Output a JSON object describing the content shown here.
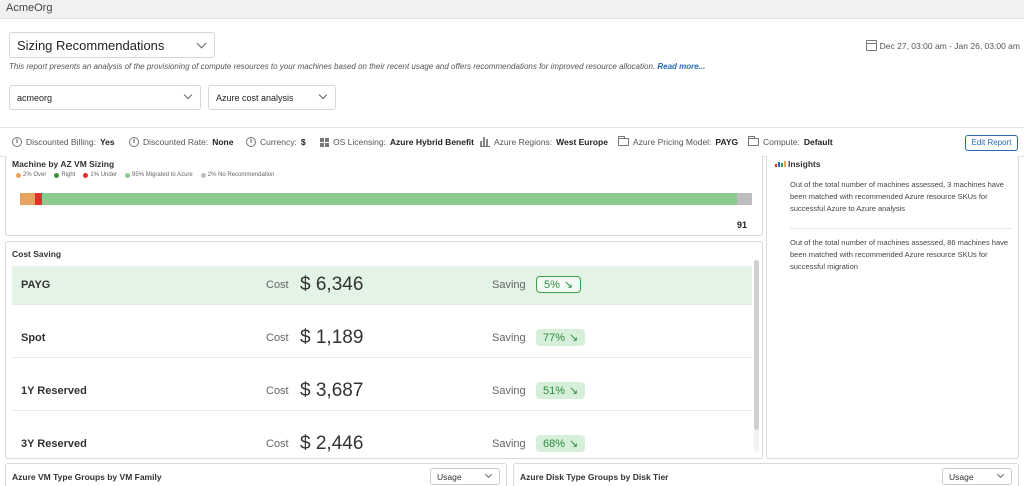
{
  "app": {
    "org": "AcmeOrg"
  },
  "report": {
    "selected": "Sizing Recommendations",
    "date_range": "Dec 27, 03:00 am - Jan 26, 03:00 am",
    "description": "This report presents an analysis of the provisioning of compute resources to your machines based on their recent usage and offers recommendations for improved resource allocation.",
    "read_more": "Read more..."
  },
  "filters": {
    "org": "acmeorg",
    "analysis": "Azure cost analysis"
  },
  "infobar": {
    "discounted_billing": {
      "label": "Discounted Billing:",
      "value": "Yes"
    },
    "discounted_rate": {
      "label": "Discounted Rate:",
      "value": "None"
    },
    "currency": {
      "label": "Currency:",
      "value": "$"
    },
    "os_licensing": {
      "label": "OS Licensing:",
      "value": "Azure Hybrid Benefit"
    },
    "regions": {
      "label": "Azure Regions:",
      "value": "West Europe"
    },
    "pricing_model": {
      "label": "Azure Pricing Model:",
      "value": "PAYG"
    },
    "compute": {
      "label": "Compute:",
      "value": "Default"
    },
    "edit_button": "Edit Report"
  },
  "sizing": {
    "title": "Machine by AZ VM Sizing",
    "legend": [
      {
        "label": "2% Over",
        "color": "#e8a25f",
        "pct": 2
      },
      {
        "label": "Right",
        "color": "#3f8f3f",
        "pct": 0
      },
      {
        "label": "1% Under",
        "color": "#e0312f",
        "pct": 1
      },
      {
        "label": "95% Migrated to Azure",
        "color": "#8cc98c",
        "pct": 95
      },
      {
        "label": "2% No Recommendation",
        "color": "#bdbdbd",
        "pct": 2
      }
    ],
    "total": "91"
  },
  "insights": {
    "title": "Insights",
    "items": [
      "Out of the total number of machines assessed, 3 machines have been matched with recommended Azure resource SKUs for successful Azure to Azure analysis",
      "Out of the total number of machines assessed, 86 machines have been matched with recommended Azure resource SKUs for successful migration"
    ]
  },
  "cost_saving": {
    "title": "Cost Saving",
    "cost_label": "Cost",
    "saving_label": "Saving",
    "rows": [
      {
        "plan": "PAYG",
        "cost": "$ 6,346",
        "saving": "5%"
      },
      {
        "plan": "Spot",
        "cost": "$ 1,189",
        "saving": "77%"
      },
      {
        "plan": "1Y Reserved",
        "cost": "$ 3,687",
        "saving": "51%"
      },
      {
        "plan": "3Y Reserved",
        "cost": "$ 2,446",
        "saving": "68%"
      }
    ]
  },
  "bottom": {
    "vm_groups": {
      "title": "Azure VM Type Groups by VM Family",
      "select": "Usage"
    },
    "disk_groups": {
      "title": "Azure Disk Type Groups by Disk Tier",
      "select": "Usage"
    }
  }
}
